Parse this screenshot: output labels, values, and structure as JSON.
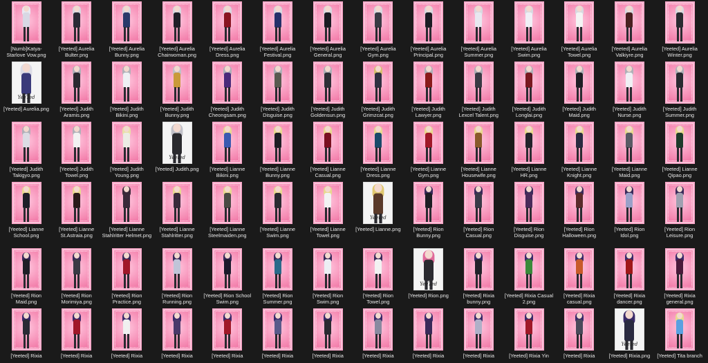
{
  "files": [
    {
      "label": "[Numb]Katya-Starlove Vow.png",
      "thumb": "pink",
      "hair": "#e9e9f2",
      "outfit": "#d8d8e4"
    },
    {
      "label": "[Yeeted] Aurelia Bulter.png",
      "thumb": "pink",
      "hair": "#d8d8e0",
      "outfit": "#2a2a35"
    },
    {
      "label": "[Yeeted] Aurelia Bunny.png",
      "thumb": "pink",
      "hair": "#d8d8e0",
      "outfit": "#2b3a6a"
    },
    {
      "label": "[Yeeted] Aurelia Chairwoman.png",
      "thumb": "pink",
      "hair": "#d8d8e0",
      "outfit": "#1f1f28"
    },
    {
      "label": "[Yeeted] Aurelia Dress.png",
      "thumb": "pink",
      "hair": "#d8d8e0",
      "outfit": "#8a1420"
    },
    {
      "label": "[Yeeted] Aurelia Festival.png",
      "thumb": "pink",
      "hair": "#d8d8e0",
      "outfit": "#25306a"
    },
    {
      "label": "[Yeeted] Aurelia General.png",
      "thumb": "pink",
      "hair": "#d8d8e0",
      "outfit": "#1a1a22"
    },
    {
      "label": "[Yeeted] Aurelia Gym.png",
      "thumb": "pink",
      "hair": "#d8d8e0",
      "outfit": "#3a3a44"
    },
    {
      "label": "[Yeeted] Aurelia Principal.png",
      "thumb": "pink",
      "hair": "#d8d8e0",
      "outfit": "#1c1c24"
    },
    {
      "label": "[Yeeted] Aurelia Summer.png",
      "thumb": "pink",
      "hair": "#d8d8e0",
      "outfit": "#e8e8f0"
    },
    {
      "label": "[Yeeted] Aurelia Swim.png",
      "thumb": "pink",
      "hair": "#d8d8e0",
      "outfit": "#f0f0f6"
    },
    {
      "label": "[Yeeted] Aurelia Towel.png",
      "thumb": "pink",
      "hair": "#d8d8e0",
      "outfit": "#f4f4f4"
    },
    {
      "label": "[Yeeted] Aurelia Valkiyre.png",
      "thumb": "pink",
      "hair": "#d8d8e0",
      "outfit": "#4a2020"
    },
    {
      "label": "[Yeeted] Aurelia Winter.png",
      "thumb": "pink",
      "hair": "#d8d8e0",
      "outfit": "#2a2a30"
    },
    {
      "label": "[Yeeted] Aurelia.png",
      "thumb": "white",
      "hair": "#dcdce6",
      "outfit": "#3a3a7a",
      "sig": "YeeTed"
    },
    {
      "label": "[Yeeted] Judith Aramis.png",
      "thumb": "pink",
      "hair": "#b0b0b8",
      "outfit": "#2a2a30"
    },
    {
      "label": "[Yeeted] Judith Bikini.png",
      "thumb": "pink",
      "hair": "#b0b0b8",
      "outfit": "#eef0f4"
    },
    {
      "label": "[Yeeted] Judith Bunny.png",
      "thumb": "pink",
      "hair": "#c0c0c8",
      "outfit": "#c99a3a"
    },
    {
      "label": "[Yeeted] Judith Cheongsam.png",
      "thumb": "pink",
      "hair": "#b0b0b8",
      "outfit": "#4a2a7a"
    },
    {
      "label": "[Yeeted] Judith Disguise.png",
      "thumb": "pink",
      "hair": "#b0b0b8",
      "outfit": "#5a5a50"
    },
    {
      "label": "[Yeeted] Judith Goldensun.png",
      "thumb": "pink",
      "hair": "#b0b0b8",
      "outfit": "#2e2e36"
    },
    {
      "label": "[Yeeted] Judith Grimzcat.png",
      "thumb": "pink",
      "hair": "#d8c070",
      "outfit": "#303040"
    },
    {
      "label": "[Yeeted] Judith Lawyer.png",
      "thumb": "pink",
      "hair": "#b0b0b8",
      "outfit": "#8a1a1a"
    },
    {
      "label": "[Yeeted] Judith Lexcel Talent.png",
      "thumb": "pink",
      "hair": "#b0b0b8",
      "outfit": "#3a3a44"
    },
    {
      "label": "[Yeeted] Judith Longlai.png",
      "thumb": "pink",
      "hair": "#b0b0b8",
      "outfit": "#7a1820"
    },
    {
      "label": "[Yeeted] Judith Maid.png",
      "thumb": "pink",
      "hair": "#b0b0b8",
      "outfit": "#1e1e24"
    },
    {
      "label": "[Yeeted] Judith Nurse.png",
      "thumb": "pink",
      "hair": "#b0b0b8",
      "outfit": "#f0f0f4"
    },
    {
      "label": "[Yeeted] Judith Summer.png",
      "thumb": "pink",
      "hair": "#b0b0b8",
      "outfit": "#2a2a30"
    },
    {
      "label": "[Yeeted] Judith Takigyo.png",
      "thumb": "pink",
      "hair": "#b0b0b8",
      "outfit": "#dcdce4"
    },
    {
      "label": "[Yeeted] Judith Towel.png",
      "thumb": "pink",
      "hair": "#b0b0b8",
      "outfit": "#f2f2f2"
    },
    {
      "label": "[Yeeted] Judith Young.png",
      "thumb": "pink",
      "hair": "#e8e0a8",
      "outfit": "#ecece4"
    },
    {
      "label": "[Yeeted] Judith.png",
      "thumb": "white",
      "hair": "#c0c0c8",
      "outfit": "#2a2a2e",
      "sig": "Yeeted"
    },
    {
      "label": "[Yeeted] Lianne Bikini.png",
      "thumb": "pink",
      "hair": "#e8d890",
      "outfit": "#3a5ab0"
    },
    {
      "label": "[Yeeted] Lianne Bunny.png",
      "thumb": "pink",
      "hair": "#e8d890",
      "outfit": "#1e1e24"
    },
    {
      "label": "[Yeeted] Lianne Casual.png",
      "thumb": "pink",
      "hair": "#e8d890",
      "outfit": "#7a1020"
    },
    {
      "label": "[Yeeted] Lianne Dress.png",
      "thumb": "pink",
      "hair": "#e8d890",
      "outfit": "#1a4a6a"
    },
    {
      "label": "[Yeeted] Lianne Gym.png",
      "thumb": "pink",
      "hair": "#e8d890",
      "outfit": "#a01828"
    },
    {
      "label": "[Yeeted] Lianne Housewife.png",
      "thumb": "pink",
      "hair": "#e8d890",
      "outfit": "#8a5a2a"
    },
    {
      "label": "[Yeeted] Lianne HR.png",
      "thumb": "pink",
      "hair": "#e8d890",
      "outfit": "#22222a"
    },
    {
      "label": "[Yeeted] Lianne Knight.png",
      "thumb": "pink",
      "hair": "#e8d890",
      "outfit": "#2a2a40"
    },
    {
      "label": "[Yeeted] Lianne Maid.png",
      "thumb": "pink",
      "hair": "#e8d890",
      "outfit": "#5a5a64"
    },
    {
      "label": "[Yeeted] Lianne Qipao.png",
      "thumb": "pink",
      "hair": "#e8d890",
      "outfit": "#1e3a2a"
    },
    {
      "label": "[Yeeted] Lianne School.png",
      "thumb": "pink",
      "hair": "#e8d890",
      "outfit": "#1e1e28"
    },
    {
      "label": "[Yeeted] Lianne St.Astraia.png",
      "thumb": "pink",
      "hair": "#e8d890",
      "outfit": "#2a1a1a"
    },
    {
      "label": "[Yeeted] Lianne Stahlritter Helmet.png",
      "thumb": "pink",
      "hair": "#3a2a3a",
      "outfit": "#3a2a3a"
    },
    {
      "label": "[Yeeted] Lianne Stahlritter.png",
      "thumb": "pink",
      "hair": "#e8d890",
      "outfit": "#3a2a3a"
    },
    {
      "label": "[Yeeted] Lianne Steelmaiden.png",
      "thumb": "pink",
      "hair": "#e8d890",
      "outfit": "#4a4a44"
    },
    {
      "label": "[Yeeted] Lianne Swim.png",
      "thumb": "pink",
      "hair": "#e8d890",
      "outfit": "#2a2a30"
    },
    {
      "label": "[Yeeted] Lianne Towel.png",
      "thumb": "pink",
      "hair": "#e8d890",
      "outfit": "#f2f2f2"
    },
    {
      "label": "[Yeeted] Lianne.png",
      "thumb": "white",
      "hair": "#e0c870",
      "outfit": "#5a3a2a",
      "sig": "Yeeted"
    },
    {
      "label": "[Yeeted] Rion Bunny.png",
      "thumb": "pink",
      "hair": "#3a2a5a",
      "outfit": "#1e1e24"
    },
    {
      "label": "[Yeeted] Rion Casual.png",
      "thumb": "pink",
      "hair": "#3a2a5a",
      "outfit": "#3a3a48"
    },
    {
      "label": "[Yeeted] Rion Disguise.png",
      "thumb": "pink",
      "hair": "#3a2a5a",
      "outfit": "#4a2a5a"
    },
    {
      "label": "[Yeeted] Rion Halloween.png",
      "thumb": "pink",
      "hair": "#3a2a5a",
      "outfit": "#5a2a2a"
    },
    {
      "label": "[Yeeted] Rion Idol.png",
      "thumb": "pink",
      "hair": "#3a2a5a",
      "outfit": "#9aa0c8"
    },
    {
      "label": "[Yeeted] Rion Leisure.png",
      "thumb": "pink",
      "hair": "#3a2a5a",
      "outfit": "#a0a0b0"
    },
    {
      "label": "[Yeeted] Rion Maid.png",
      "thumb": "pink",
      "hair": "#3a2a5a",
      "outfit": "#1e1e26"
    },
    {
      "label": "[Yeeted] Rion Morimiya.png",
      "thumb": "pink",
      "hair": "#3a2a5a",
      "outfit": "#3a3a44"
    },
    {
      "label": "[Yeeted] Rion Practice.png",
      "thumb": "pink",
      "hair": "#3a2a5a",
      "outfit": "#a01828"
    },
    {
      "label": "[Yeeted] Rion Running.png",
      "thumb": "pink",
      "hair": "#3a2a5a",
      "outfit": "#c0c4d8"
    },
    {
      "label": "[Yeeted] Rion School Swim.png",
      "thumb": "pink",
      "hair": "#3a2a5a",
      "outfit": "#1a1a2a"
    },
    {
      "label": "[Yeeted] Rion Summer.png",
      "thumb": "pink",
      "hair": "#3a2a5a",
      "outfit": "#2a6a8a"
    },
    {
      "label": "[Yeeted] Rion Swim.png",
      "thumb": "pink",
      "hair": "#3a2a5a",
      "outfit": "#eceff4"
    },
    {
      "label": "[Yeeted] Rion Towel.png",
      "thumb": "pink",
      "hair": "#3a2a5a",
      "outfit": "#f2f2f2"
    },
    {
      "label": "[Yeeted] Rion.png",
      "thumb": "white",
      "hair": "#e06a9a",
      "outfit": "#2a2a30",
      "sig": "YeeTed"
    },
    {
      "label": "[Yeeted] Rixia bunny.png",
      "thumb": "pink",
      "hair": "#3a2a6a",
      "outfit": "#22222a"
    },
    {
      "label": "[Yeeted] Rixia Casual 2.png",
      "thumb": "pink",
      "hair": "#3a2a6a",
      "outfit": "#3a8a3a"
    },
    {
      "label": "[Yeeted] Rixia casual.png",
      "thumb": "pink",
      "hair": "#3a2a6a",
      "outfit": "#c85a2a"
    },
    {
      "label": "[Yeeted] Rixia dancer.png",
      "thumb": "pink",
      "hair": "#3a2a6a",
      "outfit": "#a01818"
    },
    {
      "label": "[Yeeted] Rixia general.png",
      "thumb": "pink",
      "hair": "#3a2a6a",
      "outfit": "#4a1a3a"
    },
    {
      "label": "[Yeeted] Rixia",
      "thumb": "pink",
      "hair": "#3a2a6a",
      "outfit": "#2a2a34"
    },
    {
      "label": "[Yeeted] Rixia",
      "thumb": "pink",
      "hair": "#3a2a6a",
      "outfit": "#a01828"
    },
    {
      "label": "[Yeeted] Rixia",
      "thumb": "pink",
      "hair": "#3a2a6a",
      "outfit": "#f0f0f0"
    },
    {
      "label": "[Yeeted] Rixia",
      "thumb": "pink",
      "hair": "#3a2a6a",
      "outfit": "#4a3a6a"
    },
    {
      "label": "[Yeeted] Rixia",
      "thumb": "pink",
      "hair": "#3a2a6a",
      "outfit": "#a01828"
    },
    {
      "label": "[Yeeted] Rixia",
      "thumb": "pink",
      "hair": "#3a2a6a",
      "outfit": "#5a5a8a"
    },
    {
      "label": "[Yeeted] Rixia",
      "thumb": "pink",
      "hair": "#3a2a6a",
      "outfit": "#2a2a30"
    },
    {
      "label": "[Yeeted] Rixia",
      "thumb": "pink",
      "hair": "#3a2a6a",
      "outfit": "#8a8aa0"
    },
    {
      "label": "[Yeeted] Rixia",
      "thumb": "pink",
      "hair": "#3a2a6a",
      "outfit": "#3a2a5a"
    },
    {
      "label": "[Yeeted] Rixia",
      "thumb": "pink",
      "hair": "#3a2a6a",
      "outfit": "#b0b0c8"
    },
    {
      "label": "[Yeeted] Rixia Yin",
      "thumb": "pink",
      "hair": "#3a2a6a",
      "outfit": "#a01828"
    },
    {
      "label": "[Yeeted] Rixia",
      "thumb": "pink",
      "hair": "#3a2a6a",
      "outfit": "#4a4a5a"
    },
    {
      "label": "[Yeeted] Rixia.png",
      "thumb": "white",
      "hair": "#3a2a6a",
      "outfit": "#2a2a40",
      "sig": "Yeeted"
    },
    {
      "label": "[Yeeted] Tita branch",
      "thumb": "pink",
      "hair": "#e8d890",
      "outfit": "#5aa0e0"
    }
  ]
}
